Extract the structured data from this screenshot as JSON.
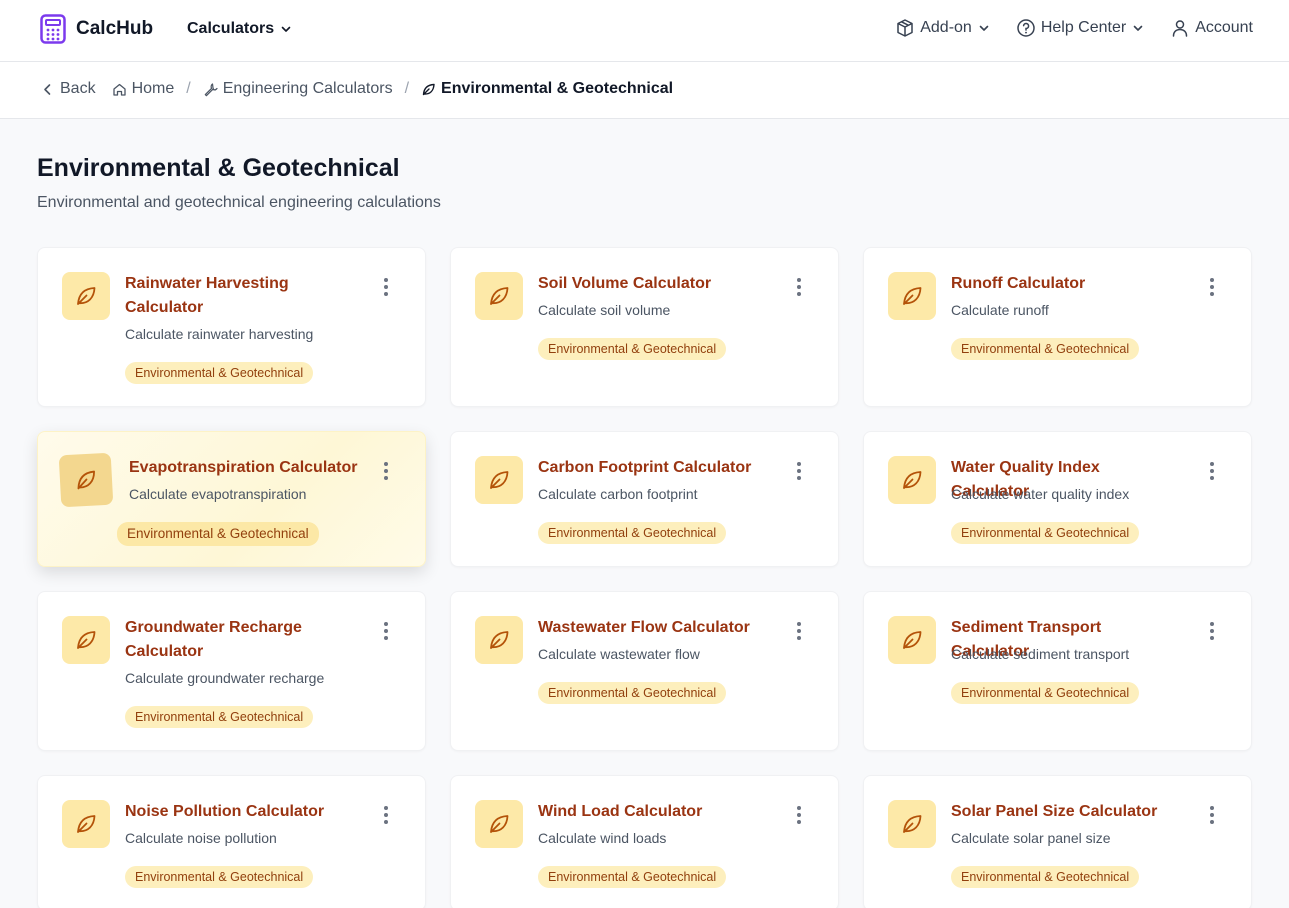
{
  "brand": {
    "name": "CalcHub"
  },
  "nav": {
    "calculators": "Calculators",
    "addon": "Add-on",
    "help": "Help Center",
    "account": "Account"
  },
  "breadcrumb": {
    "back": "Back",
    "home": "Home",
    "engineering": "Engineering Calculators",
    "current": "Environmental & Geotechnical",
    "separator": "/"
  },
  "header": {
    "title": "Environmental & Geotechnical",
    "subtitle": "Environmental and geotechnical engineering calculations"
  },
  "colors": {
    "accent": "#9a3412",
    "icon_bg": "#fde9a8",
    "badge_bg": "#fdefbd",
    "brand": "#7c3aed"
  },
  "cards": [
    {
      "title": "Rainwater Harvesting Calculator",
      "desc": "Calculate rainwater harvesting",
      "badge": "Environmental & Geotechnical",
      "icon": "leaf-icon"
    },
    {
      "title": "Soil Volume Calculator",
      "desc": "Calculate soil volume",
      "badge": "Environmental & Geotechnical",
      "icon": "leaf-icon"
    },
    {
      "title": "Runoff Calculator",
      "desc": "Calculate runoff",
      "badge": "Environmental & Geotechnical",
      "icon": "leaf-icon"
    },
    {
      "title": "Evapotranspiration Calculator",
      "desc": "Calculate evapotranspiration",
      "badge": "Environmental & Geotechnical",
      "icon": "leaf-icon"
    },
    {
      "title": "Carbon Footprint Calculator",
      "desc": "Calculate carbon footprint",
      "badge": "Environmental & Geotechnical",
      "icon": "leaf-icon"
    },
    {
      "title": "Water Quality Index Calculator",
      "desc": "Calculate water quality index",
      "badge": "Environmental & Geotechnical",
      "icon": "leaf-icon"
    },
    {
      "title": "Groundwater Recharge Calculator",
      "desc": "Calculate groundwater recharge",
      "badge": "Environmental & Geotechnical",
      "icon": "leaf-icon"
    },
    {
      "title": "Wastewater Flow Calculator",
      "desc": "Calculate wastewater flow",
      "badge": "Environmental & Geotechnical",
      "icon": "leaf-icon"
    },
    {
      "title": "Sediment Transport Calculator",
      "desc": "Calculate sediment transport",
      "badge": "Environmental & Geotechnical",
      "icon": "leaf-icon"
    },
    {
      "title": "Noise Pollution Calculator",
      "desc": "Calculate noise pollution",
      "badge": "Environmental & Geotechnical",
      "icon": "leaf-icon"
    },
    {
      "title": "Wind Load Calculator",
      "desc": "Calculate wind loads",
      "badge": "Environmental & Geotechnical",
      "icon": "leaf-icon"
    },
    {
      "title": "Solar Panel Size Calculator",
      "desc": "Calculate solar panel size",
      "badge": "Environmental & Geotechnical",
      "icon": "leaf-icon"
    }
  ]
}
